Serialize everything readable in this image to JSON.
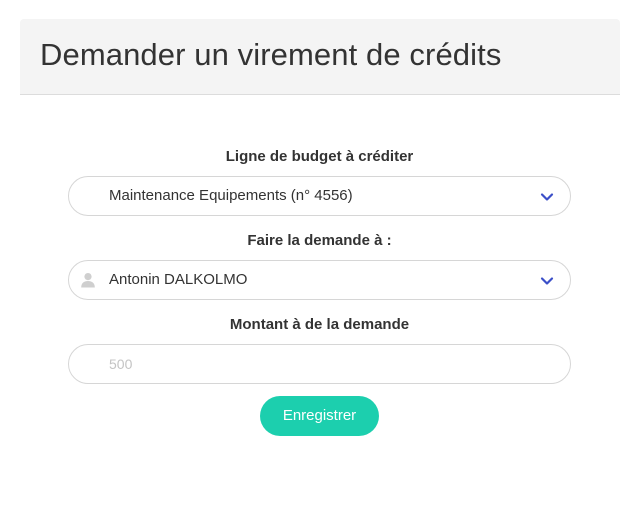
{
  "dialog": {
    "title": "Demander un virement de crédits"
  },
  "form": {
    "budget_line": {
      "label": "Ligne de budget à créditer",
      "selected": "Maintenance Equipements (n° 4556)",
      "icon": "chevron-down-icon"
    },
    "recipient": {
      "label": "Faire la demande à :",
      "selected": "Antonin DALKOLMO",
      "icon": "user-icon"
    },
    "amount": {
      "label": "Montant à de la demande",
      "value": "",
      "placeholder": "500"
    },
    "save_label": "Enregistrer"
  },
  "colors": {
    "accent": "#1ccfae",
    "chevron": "#3b4fc8",
    "header_bg": "#f4f4f4"
  }
}
